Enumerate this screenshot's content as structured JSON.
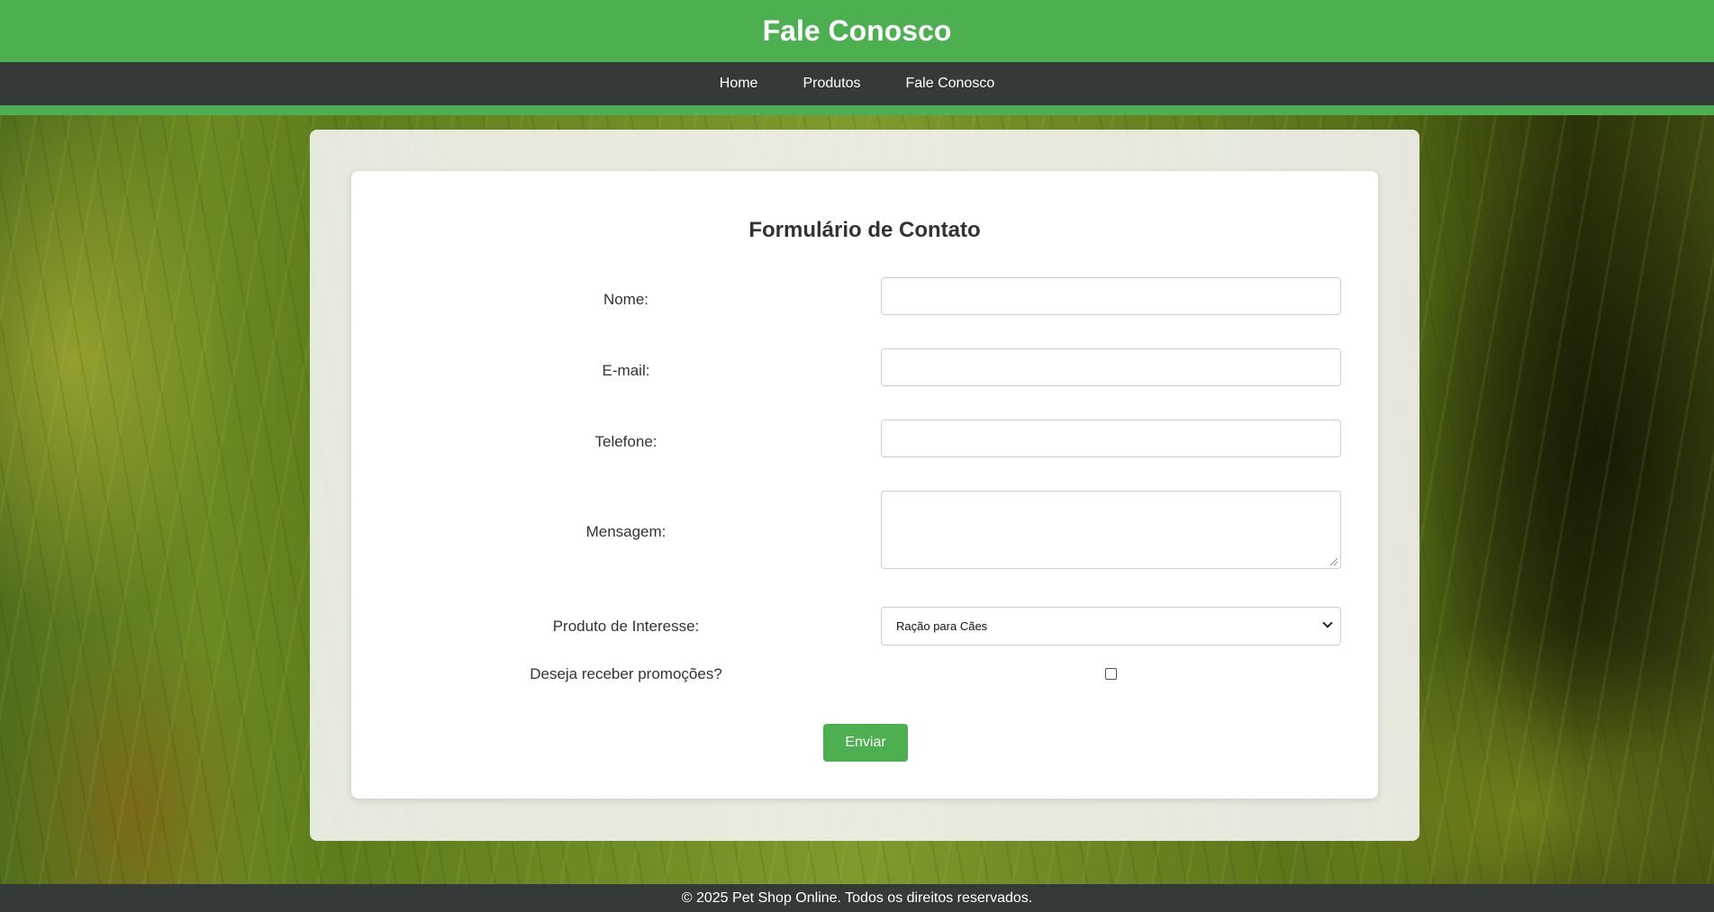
{
  "header": {
    "title": "Fale Conosco"
  },
  "nav": {
    "items": [
      "Home",
      "Produtos",
      "Fale Conosco"
    ]
  },
  "form": {
    "title": "Formulário de Contato",
    "fields": {
      "nome": {
        "label": "Nome:",
        "value": ""
      },
      "email": {
        "label": "E-mail:",
        "value": ""
      },
      "telefone": {
        "label": "Telefone:",
        "value": ""
      },
      "mensagem": {
        "label": "Mensagem:",
        "value": ""
      },
      "produto": {
        "label": "Produto de Interesse:",
        "selected": "Ração para Cães"
      },
      "promocoes": {
        "label": "Deseja receber promoções?",
        "checked": false
      }
    },
    "submit_label": "Enviar"
  },
  "footer": {
    "text": "© 2025 Pet Shop Online. Todos os direitos reservados."
  },
  "colors": {
    "accent": "#4caf50",
    "dark": "#333a37"
  }
}
